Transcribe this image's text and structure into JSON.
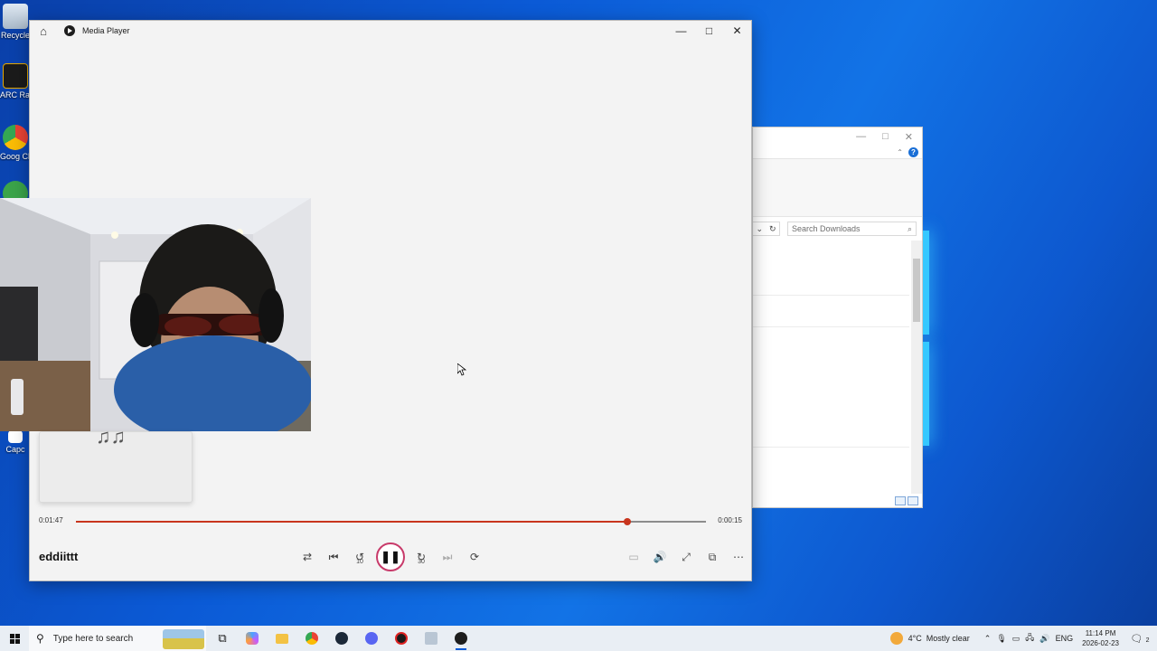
{
  "desktop": {
    "icons": [
      {
        "label": "Recycle"
      },
      {
        "label": "ARC Rai"
      },
      {
        "label": "Goog Chron"
      },
      {
        "label": ""
      },
      {
        "label": "Capc"
      }
    ]
  },
  "explorer": {
    "search_placeholder": "Search Downloads"
  },
  "player": {
    "title": "Media Player",
    "now_playing": "eddiittt",
    "elapsed": "0:01:47",
    "remaining": "0:00:15",
    "progress": 0.875,
    "controls": {
      "shuffle": "shuffle-icon",
      "previous": "previous-icon",
      "rewind_seconds": "10",
      "play_state": "pause",
      "forward_seconds": "30",
      "next": "next-icon",
      "repeat": "repeat-icon"
    },
    "accent_color": "#c8351d"
  },
  "taskbar": {
    "search_placeholder": "Type here to search",
    "weather": "4°C  Mostly clear",
    "language": "ENG",
    "time": "11:14 PM",
    "date": "2026-02-23",
    "notification_count": "2"
  }
}
